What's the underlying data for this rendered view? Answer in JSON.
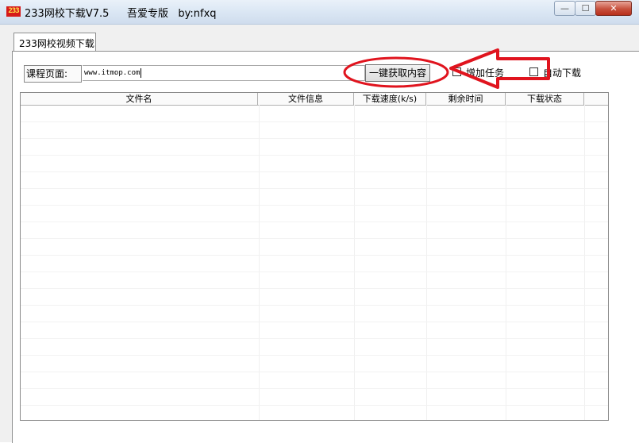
{
  "window": {
    "app_icon_text": "233",
    "title": "233网校下载V7.5",
    "subtitle": "吾爱专版   by:nfxq",
    "controls": {
      "minimize": "—",
      "maximize": "☐",
      "close": "✕"
    }
  },
  "tabs": [
    {
      "label": "233网校视频下载"
    }
  ],
  "form": {
    "course_label": "课程页面:",
    "url_value": "www.itmop.com",
    "fetch_button": "一键获取内容",
    "add_task_label": "增加任务",
    "auto_download_label": "自动下载"
  },
  "table": {
    "columns": [
      "文件名",
      "文件信息",
      "下载速度(k/s)",
      "剩余时间",
      "下载状态"
    ],
    "rows": []
  },
  "annotation": {
    "color": "#e0141e"
  }
}
